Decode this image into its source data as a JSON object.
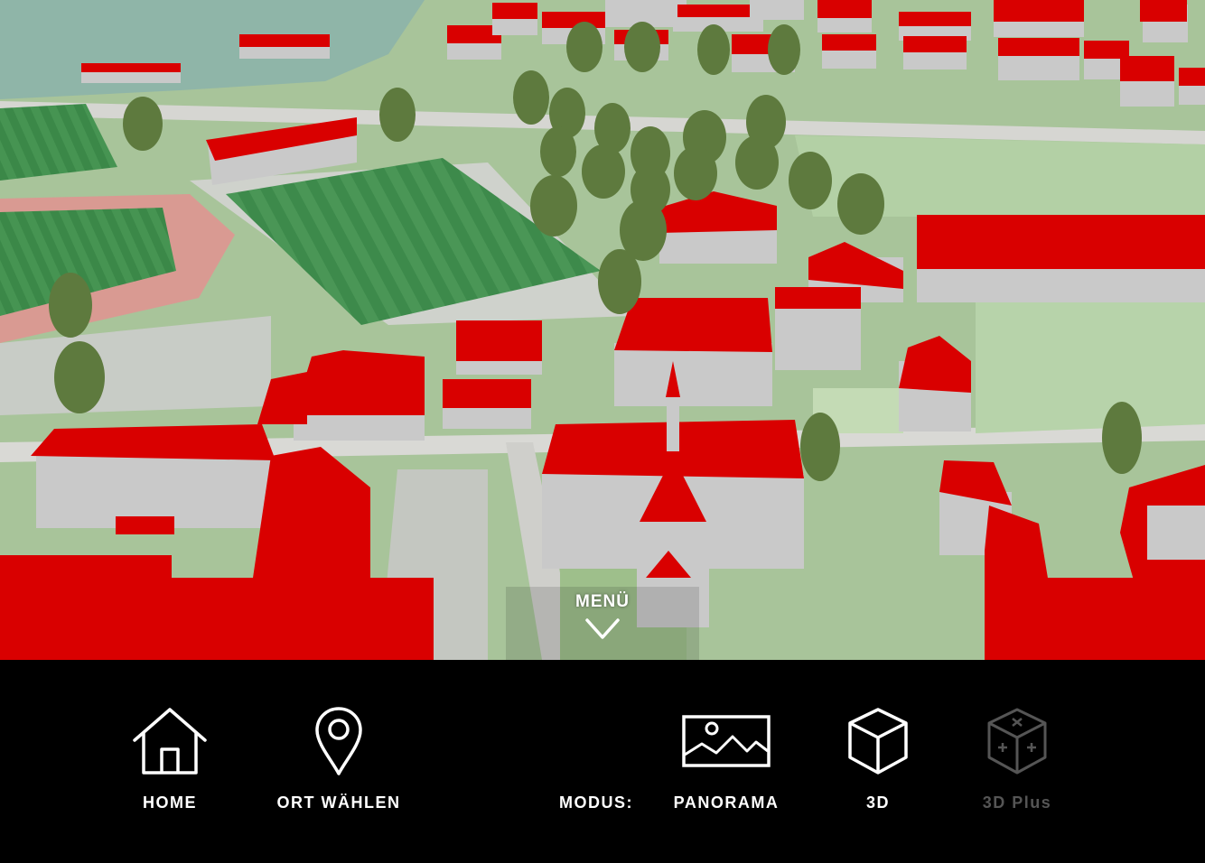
{
  "map": {
    "description_icon": "3d-city-map"
  },
  "menu_toggle": {
    "label": "MENÜ",
    "icon": "chevron-down-icon"
  },
  "nav": {
    "home": {
      "label": "HOME",
      "icon": "home-icon"
    },
    "location": {
      "label": "ORT WÄHLEN",
      "icon": "map-pin-icon"
    }
  },
  "mode": {
    "label": "MODUS:",
    "options": {
      "panorama": {
        "label": "PANORAMA",
        "icon": "image-icon"
      },
      "three_d": {
        "label": "3D",
        "icon": "cube-icon"
      },
      "three_d_plus": {
        "label": "3D Plus",
        "icon": "cube-plus-icon",
        "enabled": false
      }
    }
  },
  "colors": {
    "roof_red": "#d90000",
    "wall_gray": "#c9c9c9",
    "grass": "#9bbf8a",
    "field_green": "#3f8a4a",
    "water": "#8fb5a8",
    "bar_bg": "#000000",
    "text": "#ffffff",
    "disabled_text": "#555555"
  }
}
